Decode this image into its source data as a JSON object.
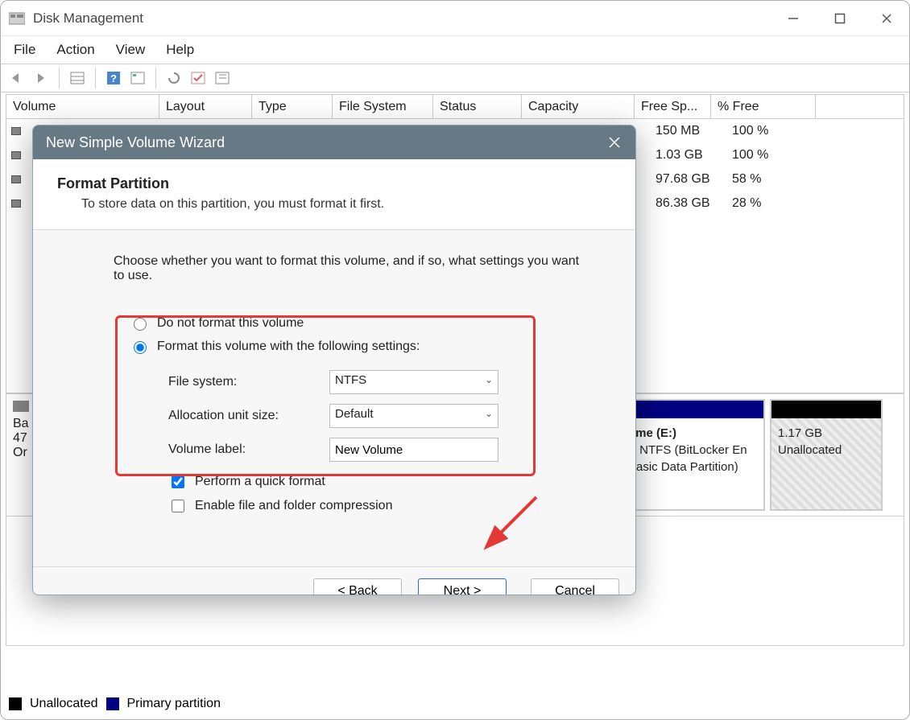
{
  "window": {
    "title": "Disk Management",
    "menu": {
      "file": "File",
      "action": "Action",
      "view": "View",
      "help": "Help"
    },
    "columns": {
      "volume": "Volume",
      "layout": "Layout",
      "type": "Type",
      "filesystem": "File System",
      "status": "Status",
      "capacity": "Capacity",
      "free": "Free Sp...",
      "pct": "% Free"
    },
    "rows": [
      {
        "free": "150 MB",
        "pct": "100 %"
      },
      {
        "free": "1.03 GB",
        "pct": "100 %"
      },
      {
        "free": "97.68 GB",
        "pct": "58 %"
      },
      {
        "free": "86.38 GB",
        "pct": "28 %"
      }
    ],
    "disk": {
      "label0": "Ba",
      "label1": "47",
      "label2": "Or"
    },
    "partition": {
      "title": "ume  (E:)",
      "line2": "B NTFS (BitLocker En",
      "line3": "Basic Data Partition)"
    },
    "unallocated": {
      "size": "1.17 GB",
      "label": "Unallocated"
    },
    "legend": {
      "unalloc": "Unallocated",
      "primary": "Primary partition"
    }
  },
  "wizard": {
    "title": "New Simple Volume Wizard",
    "header": "Format Partition",
    "subheader": "To store data on this partition, you must format it first.",
    "intro": "Choose whether you want to format this volume, and if so, what settings you want to use.",
    "radio_no_format": "Do not format this volume",
    "radio_format": "Format this volume with the following settings:",
    "labels": {
      "filesystem": "File system:",
      "alloc": "Allocation unit size:",
      "vlabel": "Volume label:"
    },
    "values": {
      "filesystem": "NTFS",
      "alloc": "Default",
      "vlabel": "New Volume"
    },
    "chk_quick": "Perform a quick format",
    "chk_compress": "Enable file and folder compression",
    "chk_quick_checked": true,
    "chk_compress_checked": false,
    "radio_selected": "format",
    "buttons": {
      "back": "< Back",
      "next": "Next >",
      "cancel": "Cancel"
    }
  }
}
